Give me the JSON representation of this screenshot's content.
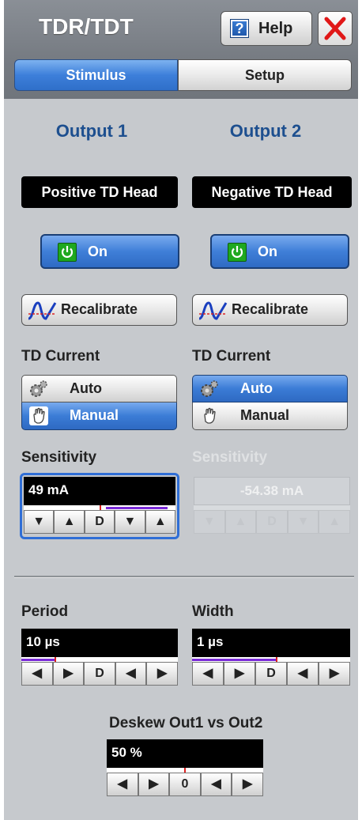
{
  "header": {
    "title": "TDR/TDT",
    "help_label": "Help",
    "help_glyph": "?",
    "close_icon": "close-x-icon"
  },
  "tabs": [
    {
      "label": "Stimulus",
      "selected": true
    },
    {
      "label": "Setup",
      "selected": false
    }
  ],
  "outputs": [
    {
      "heading": "Output 1",
      "head_name": "Positive TD Head",
      "on_label": "On",
      "recalibrate_label": "Recalibrate",
      "td_current_label": "TD Current",
      "modes": [
        {
          "label": "Auto",
          "selected": false
        },
        {
          "label": "Manual",
          "selected": true
        }
      ],
      "sensitivity_label": "Sensitivity",
      "sensitivity_value": "49 mA",
      "sensitivity_enabled": true,
      "stepper": [
        "▼",
        "▲",
        "D",
        "▼",
        "▲"
      ]
    },
    {
      "heading": "Output 2",
      "head_name": "Negative TD Head",
      "on_label": "On",
      "recalibrate_label": "Recalibrate",
      "td_current_label": "TD Current",
      "modes": [
        {
          "label": "Auto",
          "selected": true
        },
        {
          "label": "Manual",
          "selected": false
        }
      ],
      "sensitivity_label": "Sensitivity",
      "sensitivity_value": "-54.38 mA",
      "sensitivity_enabled": false,
      "stepper": [
        "▼",
        "▲",
        "D",
        "▼",
        "▲"
      ]
    }
  ],
  "period": {
    "label": "Period",
    "value": "10 µs",
    "stepper": [
      "◀",
      "▶",
      "D",
      "◀",
      "▶"
    ]
  },
  "width": {
    "label": "Width",
    "value": "1 µs",
    "stepper": [
      "◀",
      "▶",
      "D",
      "◀",
      "▶"
    ]
  },
  "deskew": {
    "label": "Deskew Out1 vs Out2",
    "value": "50 %",
    "stepper": [
      "◀",
      "▶",
      "0",
      "◀",
      "▶"
    ]
  },
  "colors": {
    "accent_blue": "#3d7fda",
    "heading_blue": "#1d4f8f",
    "panel_gray": "#c6c9cd",
    "indicator_purple": "#7a2ad8",
    "power_green": "#1fa81f"
  }
}
